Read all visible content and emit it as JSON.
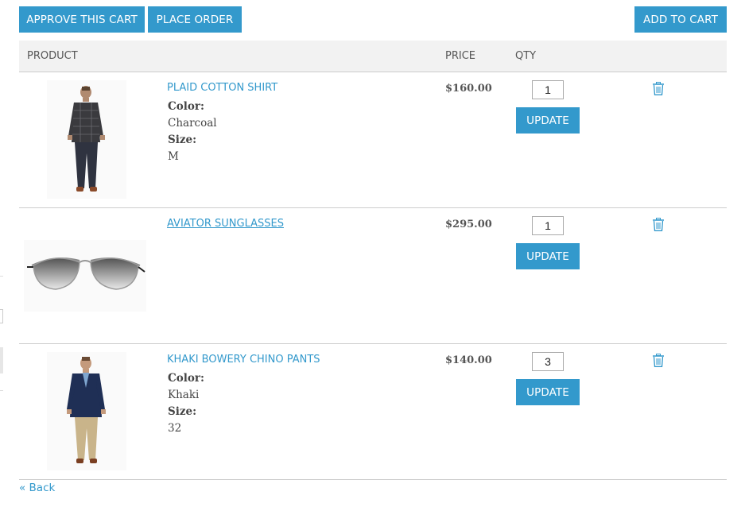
{
  "toolbar": {
    "approve_label": "APPROVE THIS CART",
    "place_order_label": "PLACE ORDER",
    "add_to_cart_label": "ADD TO CART"
  },
  "table": {
    "headers": {
      "product": "PRODUCT",
      "price": "PRICE",
      "qty": "QTY"
    },
    "rows": [
      {
        "name": "PLAID COTTON SHIRT",
        "attributes": [
          {
            "key": "Color:",
            "value": "Charcoal"
          },
          {
            "key": "Size:",
            "value": "M"
          }
        ],
        "price": "$160.00",
        "qty": "1",
        "update_label": "UPDATE",
        "image": "plaid-shirt-model"
      },
      {
        "name": "AVIATOR SUNGLASSES",
        "attributes": [],
        "price": "$295.00",
        "qty": "1",
        "update_label": "UPDATE",
        "image": "aviator-sunglasses"
      },
      {
        "name": "KHAKI BOWERY CHINO PANTS",
        "attributes": [
          {
            "key": "Color:",
            "value": "Khaki"
          },
          {
            "key": "Size:",
            "value": "32"
          }
        ],
        "price": "$140.00",
        "qty": "3",
        "update_label": "UPDATE",
        "image": "khaki-chino-model"
      }
    ]
  },
  "footer": {
    "back_label": "« Back"
  },
  "icons": {
    "remove": "trash-icon"
  },
  "colors": {
    "accent": "#3399cc",
    "header_bg": "#f2f2f2"
  }
}
